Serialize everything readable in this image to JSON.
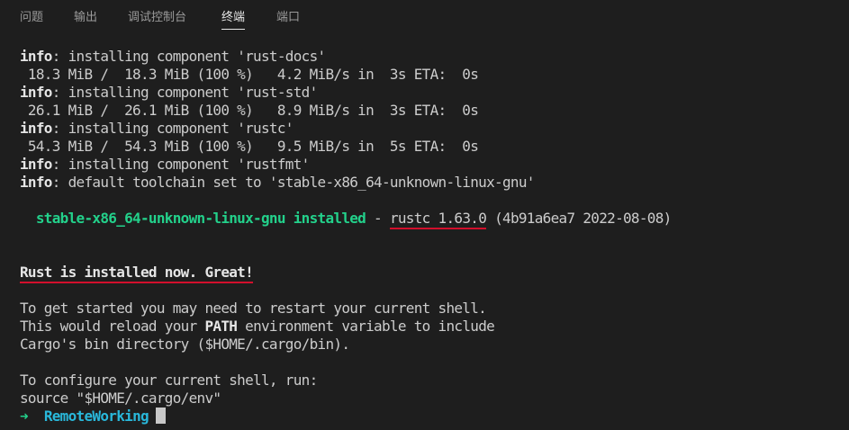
{
  "tabs": [
    {
      "label": "问题"
    },
    {
      "label": "输出"
    },
    {
      "label": "调试控制台"
    },
    {
      "label": "终端"
    },
    {
      "label": "端口"
    }
  ],
  "active_tab": "终端",
  "terminal": {
    "lines": [
      {
        "prefix": "info",
        "text": ": installing component 'rust-docs'"
      },
      {
        "text": " 18.3 MiB /  18.3 MiB (100 %)   4.2 MiB/s in  3s ETA:  0s"
      },
      {
        "prefix": "info",
        "text": ": installing component 'rust-std'"
      },
      {
        "text": " 26.1 MiB /  26.1 MiB (100 %)   8.9 MiB/s in  3s ETA:  0s"
      },
      {
        "prefix": "info",
        "text": ": installing component 'rustc'"
      },
      {
        "text": " 54.3 MiB /  54.3 MiB (100 %)   9.5 MiB/s in  5s ETA:  0s"
      },
      {
        "prefix": "info",
        "text": ": installing component 'rustfmt'"
      },
      {
        "prefix": "info",
        "text": ": default toolchain set to 'stable-x86_64-unknown-linux-gnu'"
      }
    ],
    "installed_line": {
      "toolchain": "  stable-x86_64-unknown-linux-gnu installed",
      "dash": " - ",
      "rustc_version": "rustc 1.63.0",
      "build_info": " (4b91a6ea7 2022-08-08)"
    },
    "success_message": "Rust is installed now. Great!",
    "restart_lines": [
      {
        "text": "To get started you may need to restart your current shell."
      },
      {
        "before": "This would reload your ",
        "bold": "PATH",
        "after": " environment variable to include"
      },
      {
        "text": "Cargo's bin directory ($HOME/.cargo/bin)."
      }
    ],
    "configure_lines": [
      "To configure your current shell, run:",
      "source \"$HOME/.cargo/env\""
    ],
    "prompt": {
      "arrow": "➜",
      "directory": "RemoteWorking"
    }
  }
}
